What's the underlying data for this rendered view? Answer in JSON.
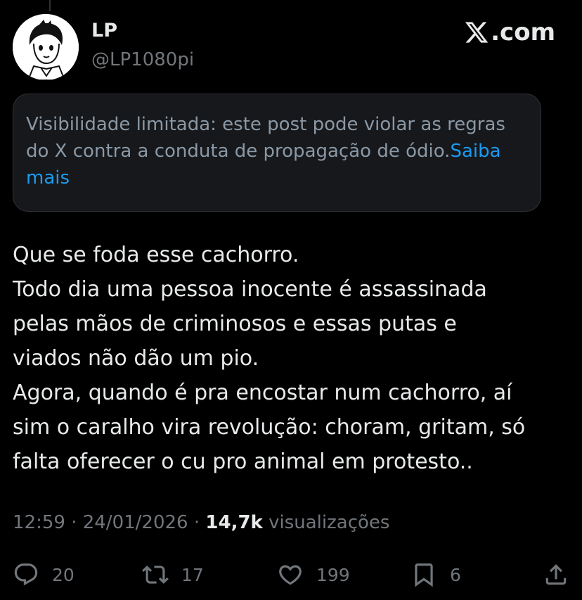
{
  "author": {
    "display_name": "LP",
    "handle": "@LP1080pi"
  },
  "brand": {
    "wordmark": ".com"
  },
  "notice": {
    "text": "Visibilidade limitada: este post pode violar as regras do X contra a conduta de propagação de ódio.",
    "link": "Saiba mais"
  },
  "tweet": {
    "lines": [
      "Que se foda esse cachorro.",
      "Todo dia uma pessoa inocente é assassinada",
      "pelas mãos de criminosos e essas putas e",
      "viados não dão um pio.",
      "Agora, quando é pra encostar num cachorro, aí",
      "sim o caralho vira revolução: choram, gritam, só",
      "falta oferecer o cu pro animal em protesto.."
    ]
  },
  "meta": {
    "time": "12:59",
    "separator": " · ",
    "date": "24/01/2026",
    "views": "14,7k",
    "views_label": "visualizações"
  },
  "actions": {
    "replies": "20",
    "reposts": "17",
    "likes": "199",
    "bookmarks": "6"
  },
  "icons": [
    "reply-icon",
    "repost-icon",
    "like-icon",
    "bookmark-icon",
    "share-icon",
    "x-logo-icon"
  ],
  "colors": {
    "background": "#000000",
    "text": "#e7e9ea",
    "secondary": "#71767b",
    "link": "#1d9bf0",
    "notice_bg": "#16181c"
  }
}
